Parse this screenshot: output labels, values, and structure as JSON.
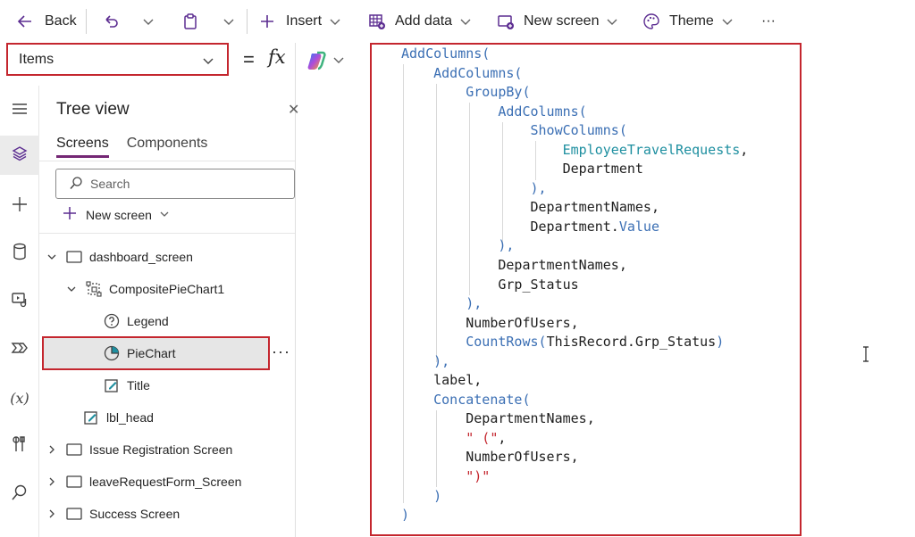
{
  "toolbar": {
    "back_label": "Back",
    "insert_label": "Insert",
    "add_data_label": "Add data",
    "new_screen_label": "New screen",
    "theme_label": "Theme",
    "more_label": "···"
  },
  "formula_bar": {
    "property": "Items",
    "equals": "=",
    "fx": "fx"
  },
  "tree": {
    "title": "Tree view",
    "close": "✕",
    "tabs": [
      "Screens",
      "Components"
    ],
    "search_placeholder": "Search",
    "new_screen_label": "New screen",
    "nodes": [
      {
        "label": "dashboard_screen"
      },
      {
        "label": "CompositePieChart1"
      },
      {
        "label": "Legend"
      },
      {
        "label": "PieChart"
      },
      {
        "label": "Title"
      },
      {
        "label": "lbl_head"
      },
      {
        "label": "Issue Registration Screen"
      },
      {
        "label": "leaveRequestForm_Screen"
      },
      {
        "label": "Success Screen"
      }
    ],
    "more": "···"
  },
  "code": [
    [
      {
        "t": "AddColumns(",
        "c": "fn"
      }
    ],
    [
      {
        "t": "    AddColumns(",
        "c": "fn"
      }
    ],
    [
      {
        "t": "        GroupBy(",
        "c": "fn"
      }
    ],
    [
      {
        "t": "            AddColumns(",
        "c": "fn"
      }
    ],
    [
      {
        "t": "                ShowColumns(",
        "c": "fn"
      }
    ],
    [
      {
        "t": "                    EmployeeTravelRequests",
        "c": "tb"
      },
      {
        "t": ",",
        "c": "id"
      }
    ],
    [
      {
        "t": "                    Department",
        "c": "id"
      }
    ],
    [
      {
        "t": "                ),",
        "c": "fn"
      }
    ],
    [
      {
        "t": "                DepartmentNames,",
        "c": "id"
      }
    ],
    [
      {
        "t": "                Department.",
        "c": "id"
      },
      {
        "t": "Value",
        "c": "fn"
      }
    ],
    [
      {
        "t": "            ),",
        "c": "fn"
      }
    ],
    [
      {
        "t": "            DepartmentNames,",
        "c": "id"
      }
    ],
    [
      {
        "t": "            Grp_Status",
        "c": "id"
      }
    ],
    [
      {
        "t": "        ),",
        "c": "fn"
      }
    ],
    [
      {
        "t": "        NumberOfUsers,",
        "c": "id"
      }
    ],
    [
      {
        "t": "        CountRows(",
        "c": "fn"
      },
      {
        "t": "ThisRecord.Grp_Status",
        "c": "id"
      },
      {
        "t": ")",
        "c": "fn"
      }
    ],
    [
      {
        "t": "    ),",
        "c": "fn"
      }
    ],
    [
      {
        "t": "    label,",
        "c": "id"
      }
    ],
    [
      {
        "t": "    Concatenate(",
        "c": "fn"
      }
    ],
    [
      {
        "t": "        DepartmentNames,",
        "c": "id"
      }
    ],
    [
      {
        "t": "        \" (\"",
        "c": "str"
      },
      {
        "t": ",",
        "c": "id"
      }
    ],
    [
      {
        "t": "        NumberOfUsers,",
        "c": "id"
      }
    ],
    [
      {
        "t": "        \")\"",
        "c": "str"
      }
    ],
    [
      {
        "t": "    )",
        "c": "fn"
      }
    ],
    [
      {
        "t": ")",
        "c": "fn"
      }
    ]
  ],
  "colors": {
    "highlight_border": "#c4262e",
    "tab_accent": "#742774",
    "function": "#3b6fb4",
    "table_ref": "#1e8fa0",
    "string": "#c4262e"
  }
}
